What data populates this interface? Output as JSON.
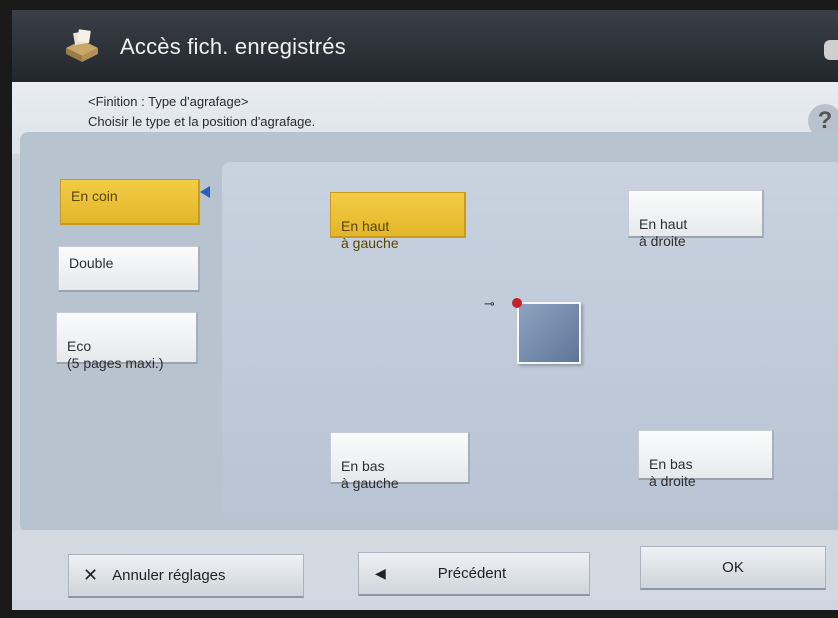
{
  "header": {
    "title": "Accès fich. enregistrés",
    "icon": "file-box-icon"
  },
  "info": {
    "line1": "<Finition : Type d'agrafage>",
    "line2": "Choisir le type et la position d'agrafage.",
    "help_label": "?"
  },
  "types": [
    {
      "label": "En coin",
      "selected": true
    },
    {
      "label": "Double",
      "selected": false
    },
    {
      "label": "Eco\n(5 pages maxi.)",
      "selected": false
    }
  ],
  "positions": {
    "top_left": "En haut\nà gauche",
    "top_right": "En haut\nà droite",
    "bottom_left": "En bas\nà gauche",
    "bottom_right": "En bas\nà droite",
    "selected": "top_left"
  },
  "footer": {
    "cancel": "Annuler réglages",
    "previous": "Précédent",
    "ok": "OK"
  },
  "colors": {
    "selected": "#e9bd33",
    "pointer": "#2b5fb8",
    "staple": "#c8202a"
  }
}
